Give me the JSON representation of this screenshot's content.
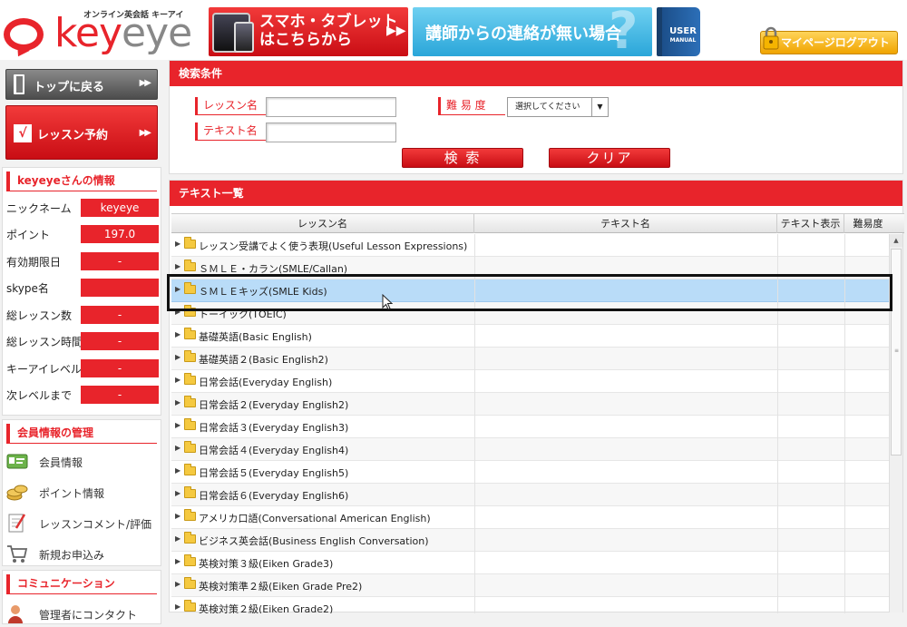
{
  "header": {
    "logo_tag": "オンライン英会話 キーアイ",
    "logo_part1": "key",
    "logo_part2": "eye",
    "smartphone_banner_line1": "スマホ・タブレット",
    "smartphone_banner_line2": "はこちらから",
    "contact_banner": "講師からの連絡が無い場合",
    "manual_line1": "USER",
    "manual_line2": "MANUAL",
    "logout_label": "マイページログアウト"
  },
  "sidebar": {
    "top_button": "トップに戻る",
    "reserve_button": "レッスン予約",
    "user_info_title": "keyeyeさんの情報",
    "user_info": [
      {
        "label": "ニックネーム",
        "value": "keyeye"
      },
      {
        "label": "ポイント",
        "value": "197.0"
      },
      {
        "label": "有効期限日",
        "value": "-"
      },
      {
        "label": "skype名",
        "value": ""
      },
      {
        "label": "総レッスン数",
        "value": "-"
      },
      {
        "label": "総レッスン時間",
        "value": "-"
      },
      {
        "label": "キーアイレベル",
        "value": "-"
      },
      {
        "label": "次レベルまで",
        "value": "-"
      }
    ],
    "member_title": "会員情報の管理",
    "member_items": [
      {
        "label": "会員情報",
        "icon": "member-card-icon"
      },
      {
        "label": "ポイント情報",
        "icon": "coins-icon"
      },
      {
        "label": "レッスンコメント/評価",
        "icon": "note-pen-icon"
      },
      {
        "label": "新規お申込み",
        "icon": "cart-icon"
      }
    ],
    "communication_title": "コミュニケーション",
    "communication_item": "管理者にコンタクト"
  },
  "search": {
    "title": "検索条件",
    "lesson_name_label": "レッスン名",
    "text_name_label": "テキスト名",
    "difficulty_label": "難 易 度",
    "difficulty_selected": "選択してください",
    "search_button": "検 索",
    "clear_button": "クリア"
  },
  "text_list": {
    "title": "テキスト一覧",
    "columns": [
      "レッスン名",
      "テキスト名",
      "テキスト表示",
      "難易度"
    ],
    "rows": [
      "レッスン受講でよく使う表現(Useful Lesson Expressions)",
      "ＳＭＬＥ・カラン(SMLE/Callan)",
      "ＳＭＬＥキッズ(SMLE Kids)",
      "トーイック(TOEIC)",
      "基礎英語(Basic English)",
      "基礎英語２(Basic English2)",
      "日常会話(Everyday English)",
      "日常会話２(Everyday English2)",
      "日常会話３(Everyday English3)",
      "日常会話４(Everyday English4)",
      "日常会話５(Everyday English5)",
      "日常会話６(Everyday English6)",
      "アメリカ口語(Conversational American English)",
      "ビジネス英会話(Business English Conversation)",
      "英検対策３級(Eiken Grade3)",
      "英検対策準２級(Eiken Grade Pre2)",
      "英検対策２級(Eiken Grade2)"
    ],
    "selected_index": 2
  },
  "colors": {
    "brand_red": "#e8242b",
    "selection_blue": "#b9dcf8",
    "gold": "#f0a400",
    "sky": "#2aa6d9"
  }
}
